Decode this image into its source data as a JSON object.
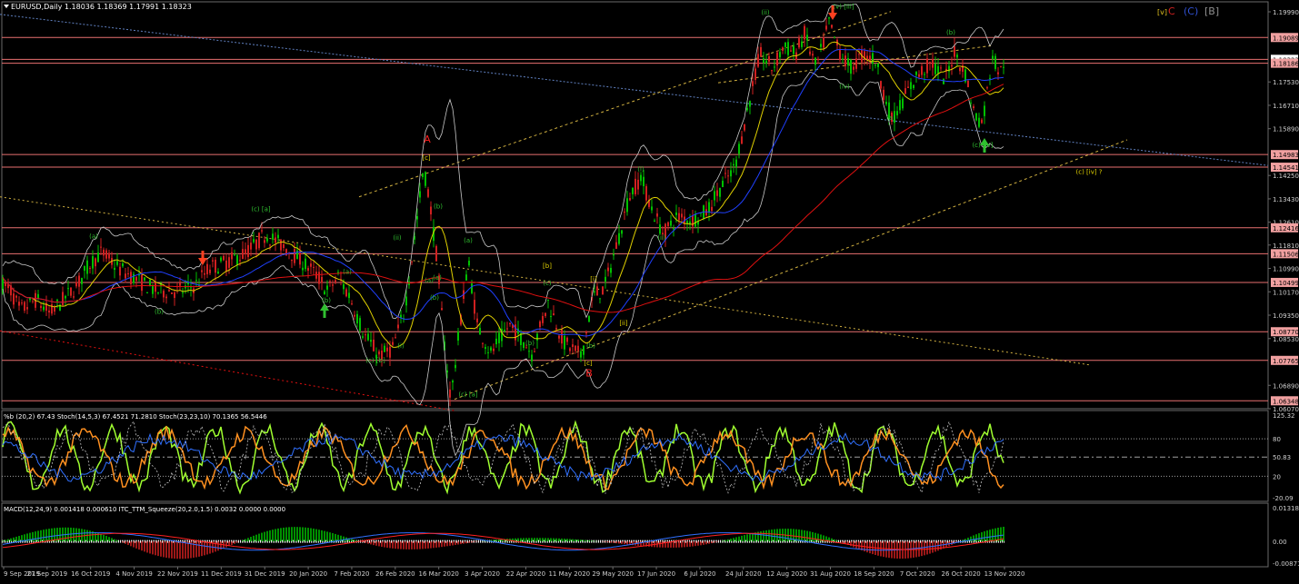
{
  "header": {
    "symbol_line": "EURUSD,Daily  1.18036 1.18369 1.17991 1.18323",
    "corner_labels": [
      "[v]",
      "C",
      "(C)",
      "[B]"
    ],
    "corner_colors": [
      "#e0c020",
      "#d02020",
      "#3050d0",
      "#909090"
    ]
  },
  "colors": {
    "background": "#000000",
    "grid": "#6a6a6a",
    "bull": "#00c000",
    "bear": "#d02020",
    "level_line": "#e87070",
    "bollinger": "#c8c8c8",
    "ma_fast": "#e0d000",
    "ma_mid": "#2040ff",
    "ma_slow": "#e01010",
    "channel": "#d0b040",
    "trendline": "#6080c0",
    "wave_green": "#30c030",
    "wave_yellow": "#e0d000",
    "wave_red": "#ff2020",
    "arrow": "#ff4020"
  },
  "chart_data": [
    {
      "type": "candlestick",
      "symbol": "EURUSD",
      "timeframe": "Daily",
      "ohlc_last": {
        "open": 1.18036,
        "high": 1.18369,
        "low": 1.17991,
        "close": 1.18323
      },
      "ylim": [
        1.0607,
        1.2034
      ],
      "price_ticks": [
        "1.19990",
        "1.17530",
        "1.16710",
        "1.15890",
        "1.14250",
        "1.13430",
        "1.12610",
        "1.11810",
        "1.10990",
        "1.10170",
        "1.09350",
        "1.08530",
        "1.06890",
        "1.06070"
      ],
      "highlighted_levels": [
        "1.19089",
        "1.18323",
        "1.18186",
        "1.14983",
        "1.14541",
        "1.12416",
        "1.11506",
        "1.10499",
        "1.08770",
        "1.07765",
        "1.06348"
      ],
      "x_labels": [
        "9 Sep 2019",
        "27 Sep 2019",
        "16 Oct 2019",
        "4 Nov 2019",
        "22 Nov 2019",
        "11 Dec 2019",
        "31 Dec 2019",
        "20 Jan 2020",
        "7 Feb 2020",
        "26 Feb 2020",
        "16 Mar 2020",
        "3 Apr 2020",
        "22 Apr 2020",
        "11 May 2020",
        "29 May 2020",
        "17 Jun 2020",
        "6 Jul 2020",
        "24 Jul 2020",
        "12 Aug 2020",
        "31 Aug 2020",
        "18 Sep 2020",
        "7 Oct 2020",
        "26 Oct 2020",
        "13 Nov 2020"
      ],
      "price_path": [
        [
          0,
          1.105
        ],
        [
          12,
          1.102
        ],
        [
          22,
          1.095
        ],
        [
          40,
          1.099
        ],
        [
          55,
          1.094
        ],
        [
          70,
          1.099
        ],
        [
          85,
          1.104
        ],
        [
          100,
          1.112
        ],
        [
          112,
          1.1155
        ],
        [
          130,
          1.11
        ],
        [
          150,
          1.106
        ],
        [
          172,
          1.102
        ],
        [
          200,
          1.102
        ],
        [
          215,
          1.104
        ],
        [
          230,
          1.11
        ],
        [
          250,
          1.112
        ],
        [
          268,
          1.115
        ],
        [
          280,
          1.118
        ],
        [
          292,
          1.122
        ],
        [
          310,
          1.118
        ],
        [
          330,
          1.113
        ],
        [
          350,
          1.107
        ],
        [
          360,
          1.102
        ],
        [
          372,
          1.107
        ],
        [
          385,
          1.1
        ],
        [
          400,
          1.087
        ],
        [
          418,
          1.079
        ],
        [
          432,
          1.082
        ],
        [
          445,
          1.095
        ],
        [
          458,
          1.125
        ],
        [
          466,
          1.145
        ],
        [
          472,
          1.135
        ],
        [
          480,
          1.115
        ],
        [
          490,
          1.08
        ],
        [
          496,
          1.064
        ],
        [
          506,
          1.09
        ],
        [
          515,
          1.113
        ],
        [
          525,
          1.09
        ],
        [
          540,
          1.08
        ],
        [
          560,
          1.09
        ],
        [
          575,
          1.085
        ],
        [
          585,
          1.08
        ],
        [
          603,
          1.098
        ],
        [
          620,
          1.084
        ],
        [
          640,
          1.079
        ],
        [
          652,
          1.1
        ],
        [
          665,
          1.103
        ],
        [
          680,
          1.12
        ],
        [
          692,
          1.135
        ],
        [
          705,
          1.142
        ],
        [
          718,
          1.13
        ],
        [
          730,
          1.122
        ],
        [
          745,
          1.128
        ],
        [
          762,
          1.127
        ],
        [
          778,
          1.13
        ],
        [
          792,
          1.138
        ],
        [
          808,
          1.145
        ],
        [
          822,
          1.165
        ],
        [
          836,
          1.185
        ],
        [
          850,
          1.18
        ],
        [
          862,
          1.188
        ],
        [
          875,
          1.185
        ],
        [
          885,
          1.192
        ],
        [
          898,
          1.18
        ],
        [
          912,
          1.196
        ],
        [
          922,
          1.187
        ],
        [
          935,
          1.18
        ],
        [
          950,
          1.185
        ],
        [
          963,
          1.183
        ],
        [
          972,
          1.172
        ],
        [
          981,
          1.162
        ],
        [
          995,
          1.17
        ],
        [
          1010,
          1.178
        ],
        [
          1025,
          1.182
        ],
        [
          1040,
          1.176
        ],
        [
          1050,
          1.186
        ],
        [
          1062,
          1.178
        ],
        [
          1072,
          1.164
        ],
        [
          1081,
          1.161
        ],
        [
          1092,
          1.185
        ],
        [
          1100,
          1.178
        ],
        [
          1105,
          1.1832
        ]
      ],
      "wave_labels": [
        {
          "text": "(v) [iii]",
          "color": "green"
        },
        {
          "text": "(ii)",
          "color": "green"
        },
        {
          "text": "(b)",
          "color": "green"
        },
        {
          "text": "(iv)",
          "color": "green"
        },
        {
          "text": "(a)",
          "color": "green"
        },
        {
          "text": "(c) [iv]",
          "color": "green"
        },
        {
          "text": "(c) [iv] ?",
          "color": "yellow"
        },
        {
          "text": "A",
          "color": "red"
        },
        {
          "text": "[c]",
          "color": "yellow"
        },
        {
          "text": "(b)",
          "color": "green"
        },
        {
          "text": "(ii)",
          "color": "green"
        },
        {
          "text": "(a)",
          "color": "green"
        },
        {
          "text": "(i)",
          "color": "green"
        },
        {
          "text": "(c) [b]",
          "color": "green"
        },
        {
          "text": "(c) [a]",
          "color": "green"
        },
        {
          "text": "(a)",
          "color": "green"
        },
        {
          "text": "(b)",
          "color": "green"
        },
        {
          "text": "[b]",
          "color": "yellow"
        },
        {
          "text": "(c)",
          "color": "green"
        },
        {
          "text": "(b)",
          "color": "green"
        },
        {
          "text": "[c]",
          "color": "yellow"
        },
        {
          "text": "B",
          "color": "red"
        },
        {
          "text": "[i]",
          "color": "yellow"
        },
        {
          "text": "[ii]",
          "color": "yellow"
        },
        {
          "text": "(i)",
          "color": "green"
        },
        {
          "text": "(ii)",
          "color": "green"
        },
        {
          "text": "(c) [a]",
          "color": "green"
        },
        {
          "text": "(a)",
          "color": "green"
        },
        {
          "text": "(b)",
          "color": "green"
        },
        {
          "text": "(a)",
          "color": "green"
        },
        {
          "text": "(b)",
          "color": "green"
        },
        {
          "text": "(a)",
          "color": "green"
        },
        {
          "text": "(b)",
          "color": "green"
        }
      ]
    },
    {
      "type": "line",
      "title": "%b (20,2) 67.43  Stoch(14,5,3) 67.4521 71.2810  Stoch(23,23,10) 70.1365 56.5446",
      "ylim": [
        -20.09,
        125.32
      ],
      "tick_labels": [
        "125.32",
        "80",
        "50.83",
        "20",
        "-20.09"
      ]
    },
    {
      "type": "bar",
      "title": "MACD(12,24,9) 0.001418 0.000610  ITC_TTM_Squeeze(20,2.0,1.5) 0.0032 0.0000 0.0000",
      "ylim": [
        -0.008719,
        0.013189
      ],
      "tick_labels": [
        "0.013189",
        "0.00",
        "-0.008719"
      ]
    }
  ]
}
